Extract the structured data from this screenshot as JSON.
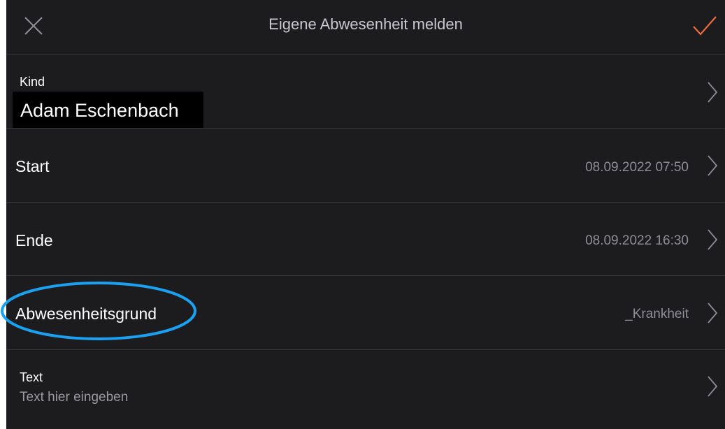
{
  "nav": {
    "title": "Eigene Abwesenheit melden",
    "close_icon": "close-icon",
    "done_icon": "checkmark-icon",
    "accent_color": "#f0693c"
  },
  "kind": {
    "label": "Kind",
    "value": "Adam Eschenbach"
  },
  "start": {
    "label": "Start",
    "value": "08.09.2022 07:50"
  },
  "ende": {
    "label": "Ende",
    "value": "08.09.2022 16:30"
  },
  "grund": {
    "label": "Abwesenheitsgrund",
    "value": "_Krankheit",
    "highlight_color": "#1ba1f2"
  },
  "text": {
    "label": "Text",
    "placeholder": "Text hier eingeben"
  }
}
